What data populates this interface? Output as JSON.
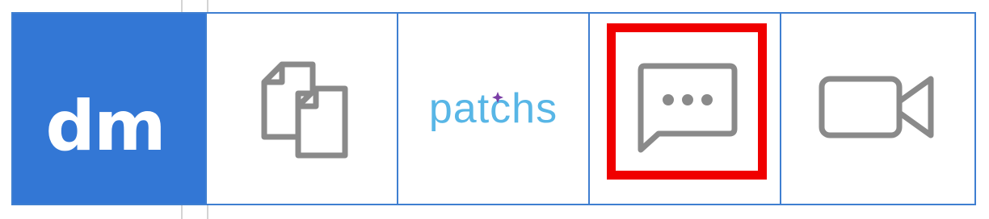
{
  "toolbar": {
    "items": [
      {
        "id": "dm",
        "label": "dm",
        "background": "#3377d5",
        "text_color": "#ffffff"
      },
      {
        "id": "copy",
        "icon": "copy-documents-icon"
      },
      {
        "id": "patchs",
        "label": "patchs",
        "text_color": "#58b6e6"
      },
      {
        "id": "chat",
        "icon": "chat-bubble-icon",
        "highlighted": true
      },
      {
        "id": "video",
        "icon": "video-camera-icon"
      }
    ]
  },
  "colors": {
    "border": "#3f7fd1",
    "icon": "#8a8a8a",
    "highlight": "#f00000",
    "patchs_dot": "#7b3fa6"
  }
}
